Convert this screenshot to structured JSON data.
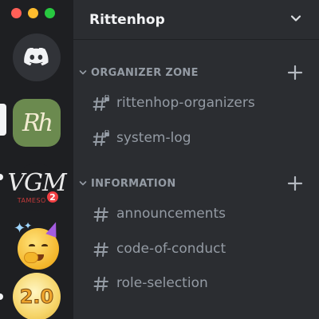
{
  "window": {
    "controls": [
      "close",
      "minimize",
      "maximize"
    ]
  },
  "rail": {
    "home": {
      "icon": "discord-logo-icon"
    },
    "servers": [
      {
        "icon_text": "Rh",
        "selected": true
      },
      {
        "icon_text": "VGM",
        "icon_subtext": "TAMESOSO",
        "mention_badge": "2"
      },
      {
        "icon": "emoji-party-face-icon"
      },
      {
        "icon_text": "2.0"
      }
    ]
  },
  "server": {
    "name": "Rittenhop"
  },
  "categories": [
    {
      "name": "ORGANIZER ZONE",
      "channels": [
        {
          "name": "rittenhop-organizers",
          "icon": "locked-text-channel-icon"
        },
        {
          "name": "system-log",
          "icon": "locked-text-channel-icon"
        }
      ]
    },
    {
      "name": "INFORMATION",
      "channels": [
        {
          "name": "announcements",
          "icon": "text-channel-icon"
        },
        {
          "name": "code-of-conduct",
          "icon": "text-channel-icon"
        },
        {
          "name": "role-selection",
          "icon": "text-channel-icon"
        }
      ]
    }
  ],
  "colors": {
    "rail_bg": "#1e1f22",
    "panel_bg": "#2b2d31",
    "text_primary": "#f2f3f5",
    "text_muted": "#949ba4",
    "badge_red": "#f23f43"
  }
}
